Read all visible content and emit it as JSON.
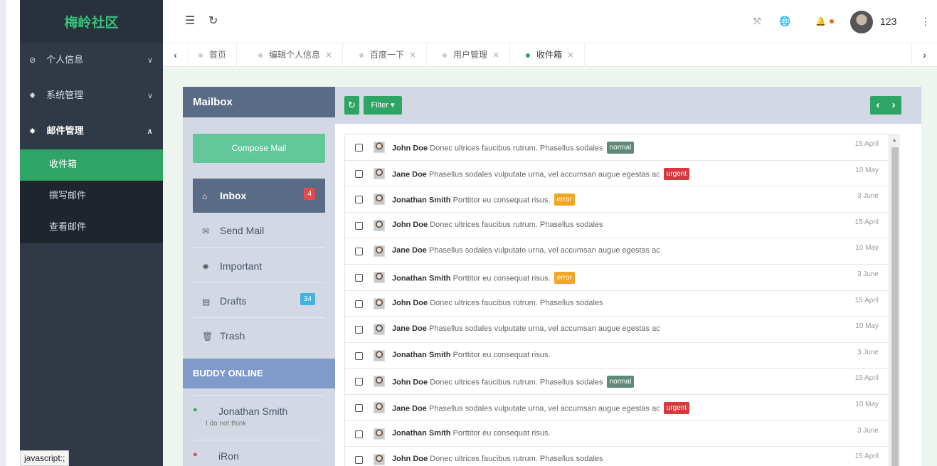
{
  "sidebar": {
    "logo": "梅岭社区",
    "menu": [
      {
        "icon": "⊘",
        "label": "个人信息",
        "arrow": "∨"
      },
      {
        "icon": "✸",
        "label": "系统管理",
        "arrow": "∨"
      },
      {
        "icon": "✸",
        "label": "邮件管理",
        "arrow": "∧"
      }
    ],
    "submenu": [
      "收件箱",
      "撰写邮件",
      "查看邮件"
    ]
  },
  "status_bar": "javascript:;",
  "header": {
    "menu_icon": "☰",
    "refresh_icon": "↻",
    "fullscreen_icon": "⤧",
    "globe_icon": "🌐",
    "bell_icon": "🔔",
    "username": "123",
    "more_icon": "⋮"
  },
  "tabs": {
    "left_arrow": "‹",
    "right_arrow": "›",
    "close": "×",
    "items": [
      "首页",
      "编辑个人信息",
      "百度一下",
      "用户管理",
      "收件箱"
    ]
  },
  "mailbox": {
    "title": "Mailbox",
    "compose": "Compose Mail",
    "folders": [
      {
        "icon": "inbox-icon",
        "label": "Inbox",
        "badge": "4"
      },
      {
        "icon": "envelope-icon",
        "label": "Send Mail",
        "badge": ""
      },
      {
        "icon": "star-icon",
        "label": "Important",
        "badge": ""
      },
      {
        "icon": "file-icon",
        "label": "Drafts",
        "badge": "34"
      },
      {
        "icon": "trash-icon",
        "label": "Trash",
        "badge": ""
      }
    ],
    "buddy_title": "BUDDY ONLINE",
    "buddies": [
      {
        "name": "Jonathan Smith",
        "status": "I do not think",
        "color": "#2ea564"
      },
      {
        "name": "iRon",
        "status": "",
        "color": "#e34a4a"
      }
    ],
    "toolbar": {
      "refresh": "↻",
      "filter": "Filter ▾",
      "prev": "‹",
      "next": "›"
    },
    "mails": [
      {
        "sender": "John Doe",
        "subject": "Donec ultrices faucibus rutrum. Phasellus sodales",
        "label": "normal",
        "date": "15 April"
      },
      {
        "sender": "Jane Doe",
        "subject": "Phasellus sodales vulputate urna, vel accumsan augue egestas ac",
        "label": "urgent",
        "date": "10 May"
      },
      {
        "sender": "Jonathan Smith",
        "subject": "Porttitor eu consequat risus.",
        "label": "error",
        "date": "3 June"
      },
      {
        "sender": "John Doe",
        "subject": "Donec ultrices faucibus rutrum. Phasellus sodales",
        "label": "",
        "date": "15 April"
      },
      {
        "sender": "Jane Doe",
        "subject": "Phasellus sodales vulputate urna, vel accumsan augue egestas ac",
        "label": "",
        "date": "10 May"
      },
      {
        "sender": "Jonathan Smith",
        "subject": "Porttitor eu consequat risus.",
        "label": "error",
        "date": "3 June"
      },
      {
        "sender": "John Doe",
        "subject": "Donec ultrices faucibus rutrum. Phasellus sodales",
        "label": "",
        "date": "15 April"
      },
      {
        "sender": "Jane Doe",
        "subject": "Phasellus sodales vulputate urna, vel accumsan augue egestas ac",
        "label": "",
        "date": "10 May"
      },
      {
        "sender": "Jonathan Smith",
        "subject": "Porttitor eu consequat risus.",
        "label": "",
        "date": "3 June"
      },
      {
        "sender": "John Doe",
        "subject": "Donec ultrices faucibus rutrum. Phasellus sodales",
        "label": "normal",
        "date": "15 April"
      },
      {
        "sender": "Jane Doe",
        "subject": "Phasellus sodales vulputate urna, vel accumsan augue egestas ac",
        "label": "urgent",
        "date": "10 May"
      },
      {
        "sender": "Jonathan Smith",
        "subject": "Porttitor eu consequat risus.",
        "label": "",
        "date": "3 June"
      },
      {
        "sender": "John Doe",
        "subject": "Donec ultrices faucibus rutrum. Phasellus sodales",
        "label": "",
        "date": "15 April"
      }
    ]
  }
}
